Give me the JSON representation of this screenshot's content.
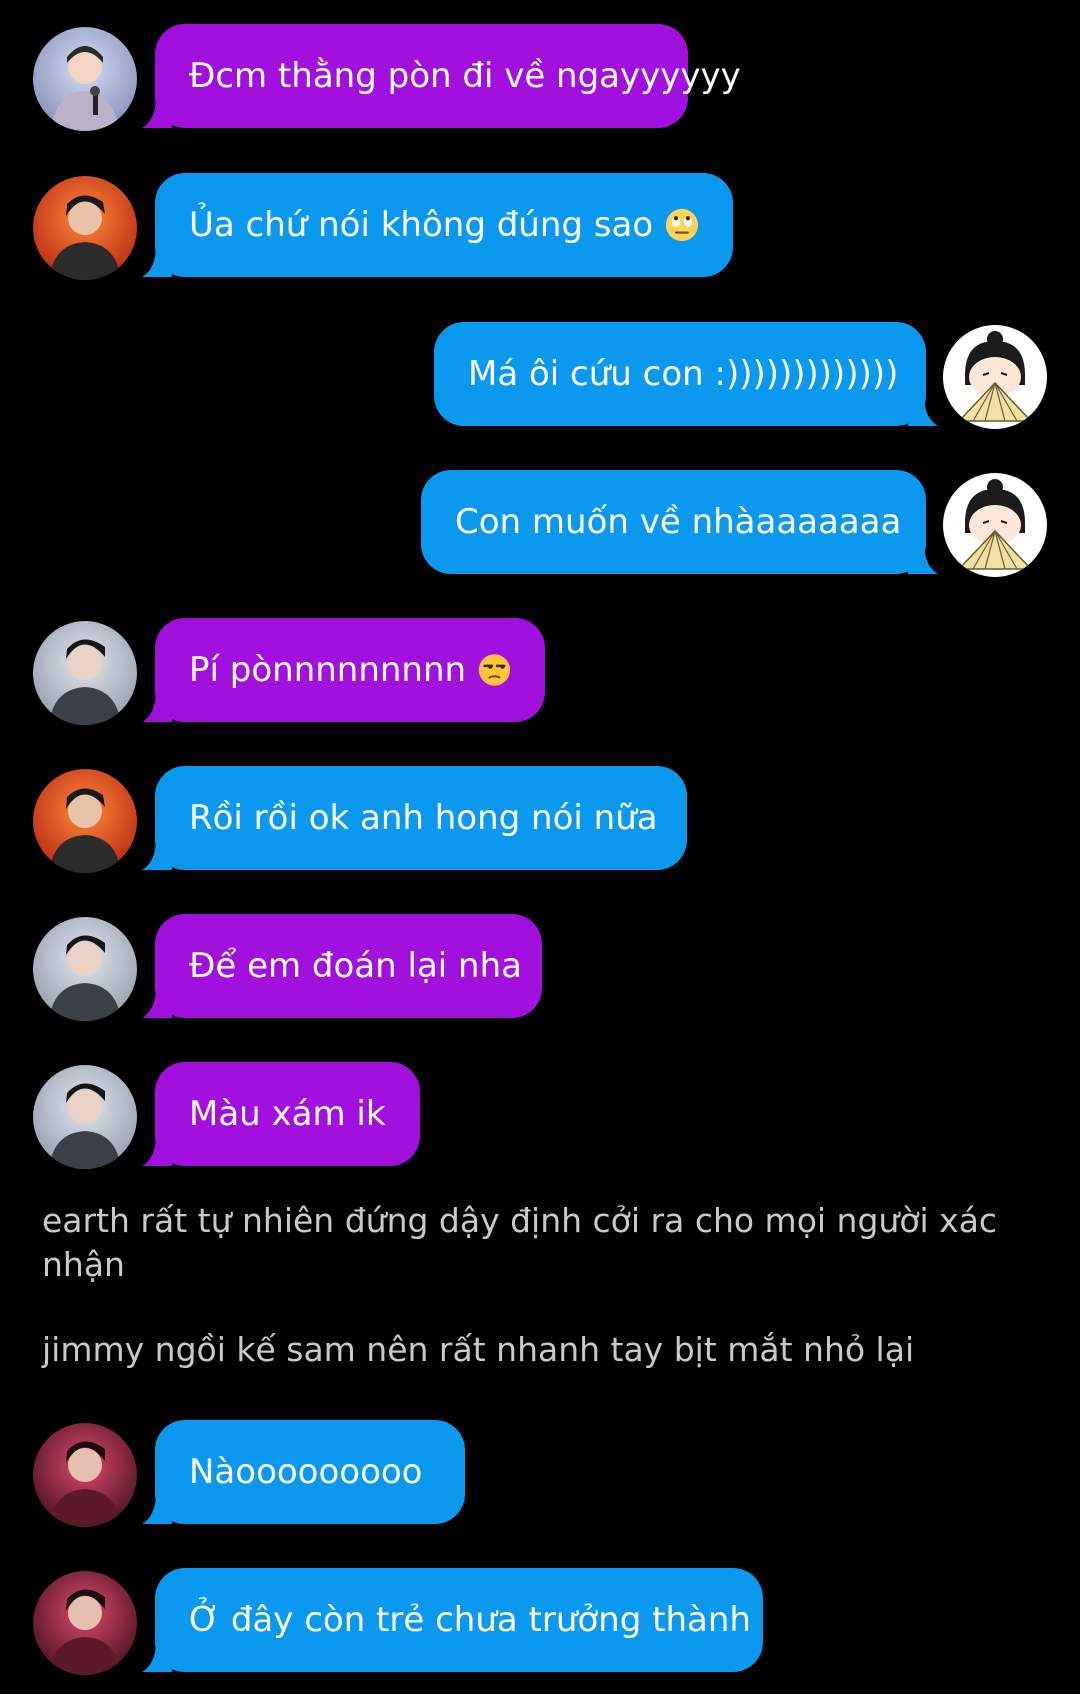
{
  "colors": {
    "background": "#000000",
    "bubble_purple": "#a110dd",
    "bubble_blue": "#0a99ef",
    "narration_text": "#c9c9c9"
  },
  "messages": [
    {
      "text": "Đcm thằng pòn đi về ngayyyyyy",
      "color": "purple",
      "side": "left",
      "avatar": "male-singer-avatar"
    },
    {
      "text": "Ủa chứ nói không đúng sao",
      "color": "blue",
      "side": "left",
      "avatar": "male-red-background-avatar",
      "emoji": "eye-roll-emoji"
    },
    {
      "text": "Má ôi cứu con :)))))))))))))",
      "color": "blue",
      "side": "right",
      "avatar": "cartoon-girl-fan-avatar"
    },
    {
      "text": "Con muốn về nhàaaaaaaa",
      "color": "blue",
      "side": "right",
      "avatar": "cartoon-girl-fan-avatar"
    },
    {
      "text": "Pí pònnnnnnnnn",
      "color": "purple",
      "side": "left",
      "avatar": "male-grey-background-avatar",
      "emoji": "unamused-emoji"
    },
    {
      "text": "Rồi rồi ok anh hong nói nữa",
      "color": "blue",
      "side": "left",
      "avatar": "male-red-background-avatar"
    },
    {
      "text": "Để em đoán lại nha",
      "color": "purple",
      "side": "left",
      "avatar": "male-grey-background-avatar"
    },
    {
      "text": "Màu xám ik",
      "color": "purple",
      "side": "left",
      "avatar": "male-grey-background-avatar"
    },
    {
      "text": "Nàooooooooo",
      "color": "blue",
      "side": "left",
      "avatar": "male-pink-background-avatar"
    },
    {
      "text": "Ở đây còn trẻ chưa trưởng thành",
      "color": "blue",
      "side": "left",
      "avatar": "male-pink-background-avatar"
    }
  ],
  "narration": [
    "earth rất tự nhiên đứng dậy định cởi ra cho mọi người xác nhận",
    "jimmy ngồi kế sam nên rất nhanh tay bịt mắt nhỏ lại"
  ]
}
